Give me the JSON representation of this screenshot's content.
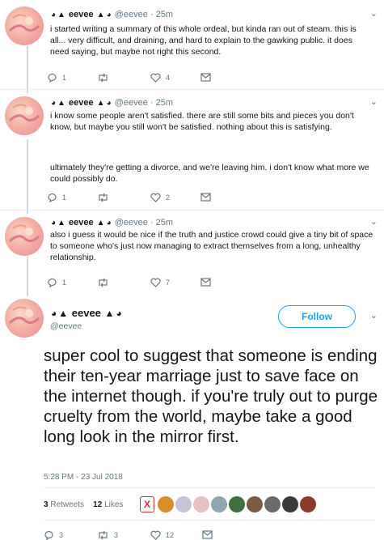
{
  "tweets": [
    {
      "name": "eevee",
      "handle": "@eevee",
      "time": "25m",
      "text": "i started writing a summary of this whole ordeal, but kinda ran out of steam. this is all... very difficult, and draining, and hard to explain to the gawking public. it does need saying, but maybe not right this second.",
      "replies": "1",
      "retweets": "",
      "likes": "4"
    },
    {
      "name": "eevee",
      "handle": "@eevee",
      "time": "25m",
      "text": "i know some people aren't satisfied. there are still some bits and pieces you don't know, but maybe you still won't be satisfied. nothing about this is satisfying.",
      "text2": "ultimately they're getting a divorce, and we're leaving him. i don't know what more we could possibly do.",
      "replies": "1",
      "retweets": "",
      "likes": "2"
    },
    {
      "name": "eevee",
      "handle": "@eevee",
      "time": "25m",
      "text": "also i guess it would be nice if the truth and justice crowd could give a tiny bit of space to someone who's just now managing to extract themselves from a long, unhealthy relationship.",
      "replies": "1",
      "retweets": "",
      "likes": "7"
    }
  ],
  "main": {
    "name": "eevee",
    "handle": "@eevee",
    "follow_label": "Follow",
    "text": "super cool to suggest that someone is ending their ten-year marriage just to save face on the internet though.  if you're truly out to purge cruelty from the world, maybe take a good long look in the mirror first.",
    "timestamp": "5:28 PM - 23 Jul 2018",
    "retweets_count": "3",
    "retweets_label": "Retweets",
    "likes_count": "12",
    "likes_label": "Likes",
    "bottom_replies": "3",
    "bottom_retweets": "3",
    "bottom_likes": "12"
  },
  "colors": {
    "accent": "#1da1f2",
    "muted": "#657786",
    "divider": "#e6ecf0"
  }
}
